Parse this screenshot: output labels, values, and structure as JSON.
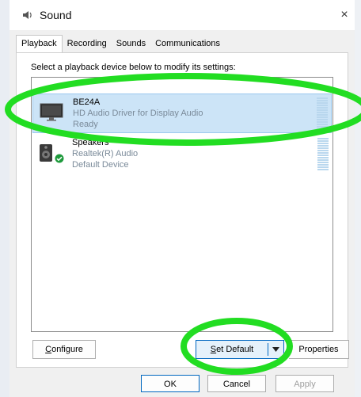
{
  "window": {
    "title": "Sound",
    "close_glyph": "×"
  },
  "tabs": [
    {
      "label": "Playback"
    },
    {
      "label": "Recording"
    },
    {
      "label": "Sounds"
    },
    {
      "label": "Communications"
    }
  ],
  "instruction": "Select a playback device below to modify its settings:",
  "devices": [
    {
      "name": "BE24A",
      "description": "HD Audio Driver for Display Audio",
      "status": "Ready",
      "icon": "monitor-icon",
      "selected": true
    },
    {
      "name": "Speakers",
      "description": "Realtek(R) Audio",
      "status": "Default Device",
      "icon": "speaker-icon",
      "badge": "default-check-icon"
    }
  ],
  "buttons": {
    "configure_first": "C",
    "configure_rest": "onfigure",
    "set_default_first": "S",
    "set_default_rest": "et Default",
    "properties": "Properties",
    "ok": "OK",
    "cancel": "Cancel",
    "apply": "Apply"
  },
  "annotation_color": "#22dd22",
  "colors": {
    "selection": "#cce4f7",
    "accent": "#0067c0"
  }
}
